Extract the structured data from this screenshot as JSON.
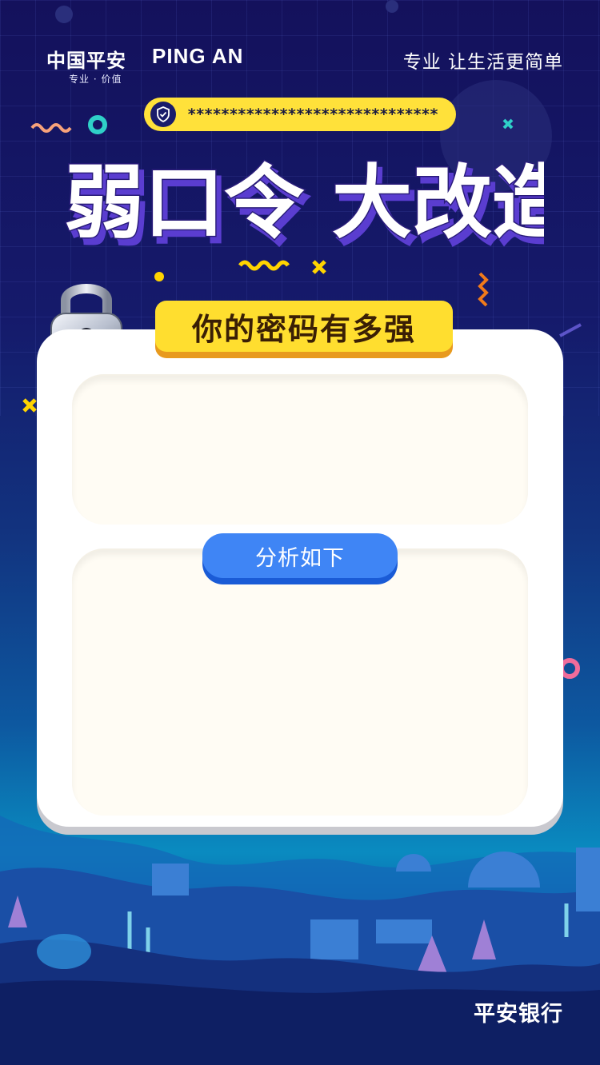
{
  "brand": {
    "name_cn": "中国平安",
    "name_en": "PING AN",
    "tagline_small": "专业 · 价值",
    "slogan": "专业 让生活更简单"
  },
  "password_bar": {
    "masked_value": "******************************",
    "icon": "shield-icon"
  },
  "headline": "弱口令 大改造",
  "subtitle": "你的密码有多强",
  "analyze_button_label": "分析如下",
  "footer_brand": "平安银行",
  "colors": {
    "accent_yellow": "#ffe13a",
    "button_blue": "#3f85f5",
    "background_navy": "#14115c"
  }
}
